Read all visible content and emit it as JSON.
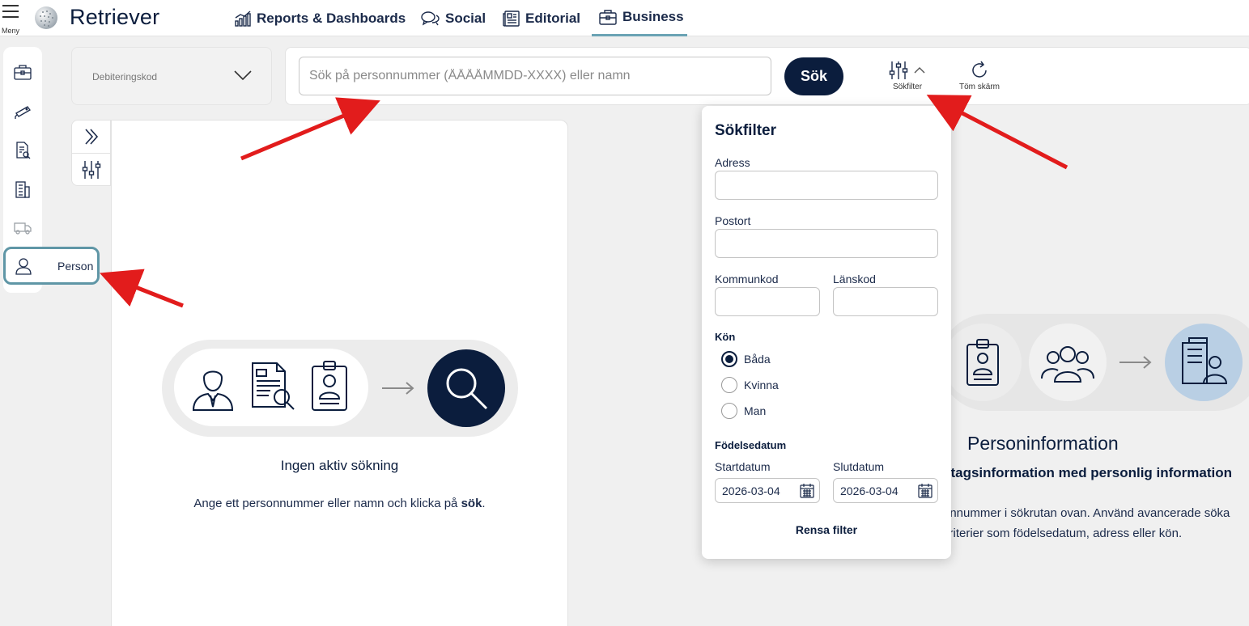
{
  "app": {
    "menu_label": "Meny",
    "brand_name": "Retriever"
  },
  "nav": {
    "items": [
      {
        "label": "Reports & Dashboards",
        "icon": "bar-chart-icon"
      },
      {
        "label": "Social",
        "icon": "chat-bubbles-icon"
      },
      {
        "label": "Editorial",
        "icon": "newspaper-icon"
      },
      {
        "label": "Business",
        "icon": "briefcase-icon",
        "active": true
      }
    ]
  },
  "sidebar": {
    "icons": [
      "briefcase-icon",
      "camera-icon",
      "document-search-icon",
      "building-icon",
      "truck-icon"
    ],
    "person_label": "Person"
  },
  "debit": {
    "label": "Debiteringskod"
  },
  "search": {
    "placeholder": "Sök på personnummer (ÅÅÅÅMMDD-XXXX) eller namn",
    "button_label": "Sök",
    "filter_label": "Sökfilter",
    "clear_label": "Töm skärm"
  },
  "empty_state": {
    "title": "Ingen aktiv sökning",
    "hint_prefix": "Ange ett personnummer eller namn och klicka på ",
    "hint_bold": "sök",
    "hint_suffix": "."
  },
  "info": {
    "title": "Personinformation",
    "subtitle": "etagsinformation med personlig information",
    "desc_line1": "onnummer i sökrutan ovan. Använd avancerade söka",
    "desc_line2": "kriterier som födelsedatum, adress eller kön."
  },
  "filter": {
    "title": "Sökfilter",
    "address_label": "Adress",
    "city_label": "Postort",
    "municipality_label": "Kommunkod",
    "county_label": "Länskod",
    "gender_label": "Kön",
    "gender_options": [
      "Båda",
      "Kvinna",
      "Man"
    ],
    "gender_selected": "Båda",
    "birthdate_label": "Födelsedatum",
    "start_label": "Startdatum",
    "end_label": "Slutdatum",
    "start_value": "2026-03-04",
    "end_value": "2026-03-04",
    "clear_label": "Rensa filter"
  },
  "colors": {
    "navy": "#0b1d3d",
    "teal_accent": "#6aa3b4",
    "annotation_red": "#e21c1c",
    "light_blue_circle": "#b9cfe4"
  }
}
